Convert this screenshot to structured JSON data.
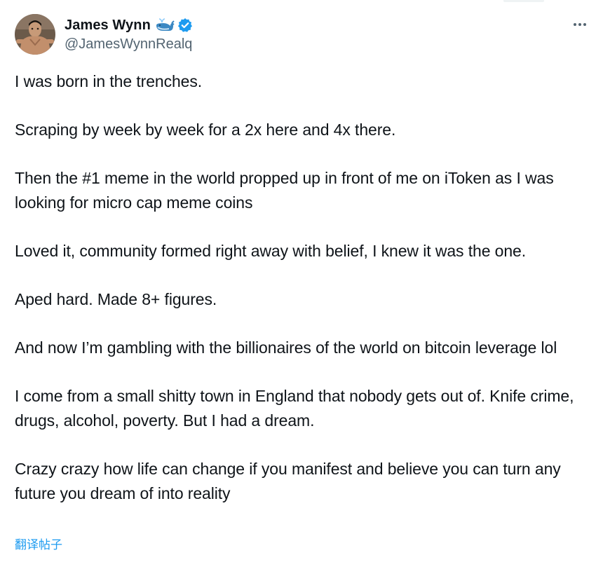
{
  "user": {
    "display_name": "James Wynn",
    "handle": "@JamesWynnRealq",
    "badge_icon": "whale-emoji-icon",
    "verified_icon": "verified-badge-icon"
  },
  "more_menu_icon": "more-options-icon",
  "tweet": {
    "paragraphs": [
      "I was born in the trenches.",
      "Scraping by week by week for a 2x here and 4x there.",
      "Then the #1 meme in the world propped up in front of me on iToken as I was looking for micro cap meme coins",
      "Loved it, community formed right away with belief, I knew it was the one.",
      "Aped hard. Made 8+ figures.",
      "And now I’m gambling with the billionaires of the world on bitcoin leverage lol",
      "I come from a small shitty town in England that nobody gets out of. Knife crime, drugs, alcohol, poverty. But I had a dream.",
      "Crazy crazy how life can change if you manifest and believe you can turn any future you dream of into reality"
    ]
  },
  "translate_label": "翻译帖子",
  "colors": {
    "text": "#0f1419",
    "secondary": "#536471",
    "link": "#1d9bf0",
    "verified": "#1d9bf0"
  }
}
